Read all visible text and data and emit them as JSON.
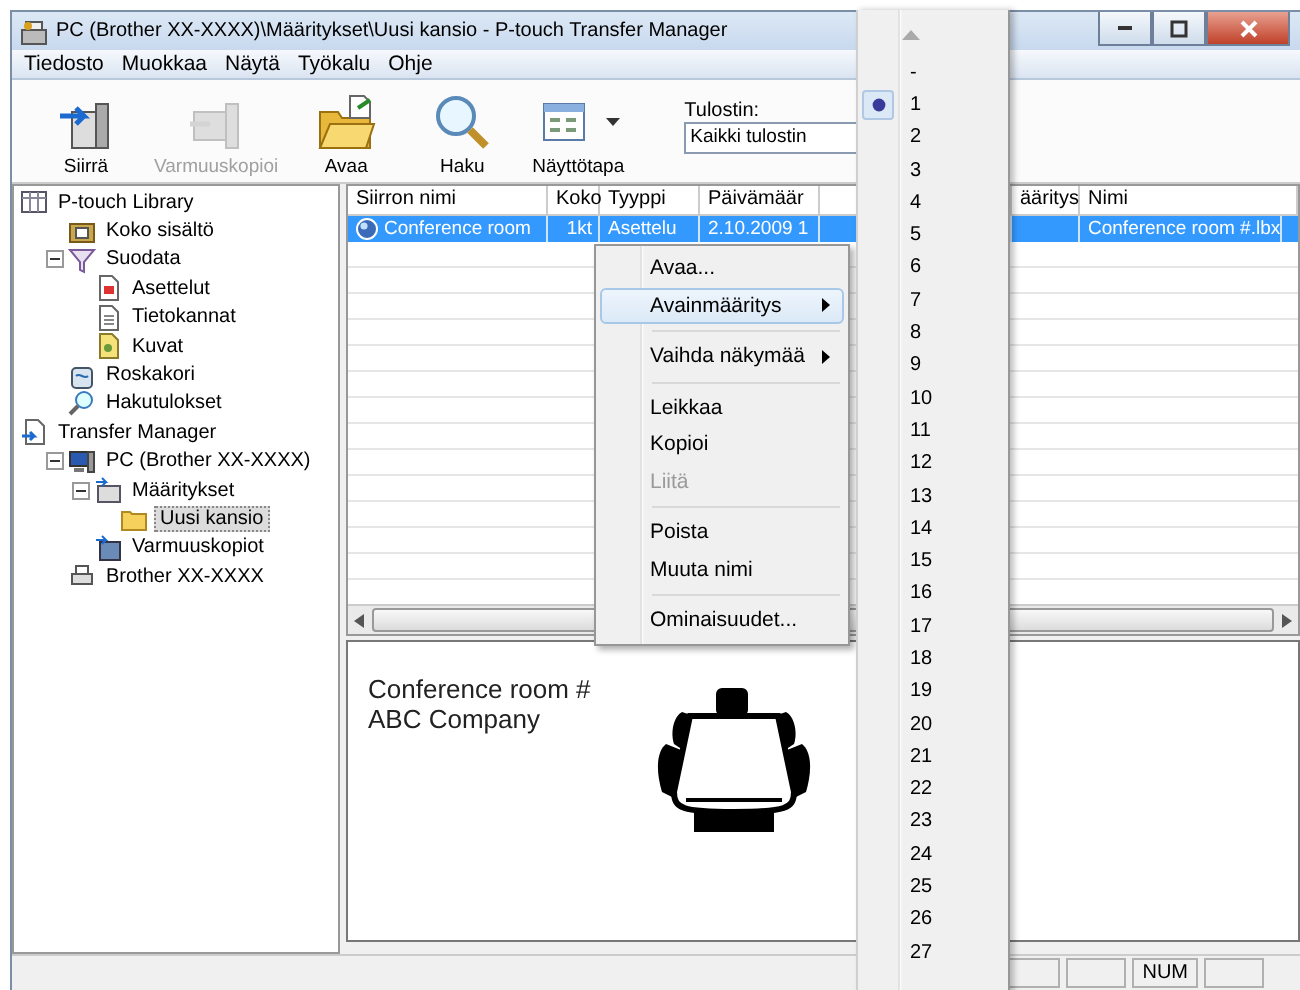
{
  "window": {
    "title": "PC (Brother XX-XXXX)\\Määritykset\\Uusi kansio - P-touch Transfer Manager"
  },
  "menu_bar": [
    "Tiedosto",
    "Muokkaa",
    "Näytä",
    "Työkalu",
    "Ohje"
  ],
  "toolbar": {
    "buttons": [
      {
        "label": "Siirrä",
        "kind": "transfer",
        "disabled": false,
        "dropdown": false
      },
      {
        "label": "Varmuuskopioi",
        "kind": "backup",
        "disabled": true,
        "dropdown": false
      },
      {
        "label": "Avaa",
        "kind": "open",
        "disabled": false,
        "dropdown": false
      },
      {
        "label": "Haku",
        "kind": "search",
        "disabled": false,
        "dropdown": false
      },
      {
        "label": "Näyttötapa",
        "kind": "view",
        "disabled": false,
        "dropdown": true
      }
    ],
    "printer": {
      "label": "Tulostin:",
      "value": "Kaikki tulostin"
    }
  },
  "tree": [
    {
      "label": "P-touch Library",
      "kind": "library",
      "selected": false,
      "children": [
        {
          "label": "Koko sisältö",
          "kind": "all",
          "selected": false
        },
        {
          "label": "Suodata",
          "kind": "filter",
          "selected": false,
          "expanded": true,
          "children": [
            {
              "label": "Asettelut",
              "kind": "layout",
              "selected": false
            },
            {
              "label": "Tietokannat",
              "kind": "database",
              "selected": false
            },
            {
              "label": "Kuvat",
              "kind": "image",
              "selected": false
            }
          ]
        },
        {
          "label": "Roskakori",
          "kind": "trash",
          "selected": false
        },
        {
          "label": "Hakutulokset",
          "kind": "search",
          "selected": false
        }
      ]
    },
    {
      "label": "Transfer Manager",
      "kind": "transfer",
      "selected": false,
      "children": [
        {
          "label": "PC (Brother XX-XXXX)",
          "kind": "pc",
          "selected": false,
          "expanded": true,
          "children": [
            {
              "label": "Määritykset",
              "kind": "config",
              "selected": false,
              "expanded": true,
              "children": [
                {
                  "label": "Uusi kansio",
                  "kind": "folder",
                  "selected": true
                }
              ]
            },
            {
              "label": "Varmuuskopiot",
              "kind": "backup",
              "selected": false
            }
          ]
        },
        {
          "label": "Brother XX-XXXX",
          "kind": "printer",
          "selected": false
        }
      ]
    }
  ],
  "list": {
    "columns": [
      "Siirron nimi",
      "Koko",
      "Tyyppi",
      "Päivämäär",
      "ääritys",
      "Nimi"
    ],
    "rows": [
      {
        "selected": true,
        "transfer_name": "Conference room",
        "size": "1kt",
        "type": "Asettelu",
        "date": "2.10.2009 1",
        "name": "Conference room #.lbx"
      }
    ]
  },
  "preview": {
    "lines": [
      "Conference room #",
      "ABC Company"
    ]
  },
  "context_menu": [
    {
      "kind": "item",
      "label": "Avaa...",
      "disabled": false,
      "selected": false,
      "submenu": false
    },
    {
      "kind": "item",
      "label": "Avainmääritys",
      "disabled": false,
      "selected": true,
      "submenu": true
    },
    {
      "kind": "separator"
    },
    {
      "kind": "item",
      "label": "Vaihda näkymää",
      "disabled": false,
      "selected": false,
      "submenu": true
    },
    {
      "kind": "separator"
    },
    {
      "kind": "item",
      "label": "Leikkaa",
      "disabled": false,
      "selected": false,
      "submenu": false
    },
    {
      "kind": "item",
      "label": "Kopioi",
      "disabled": false,
      "selected": false,
      "submenu": false
    },
    {
      "kind": "item",
      "label": "Liitä",
      "disabled": true,
      "selected": false,
      "submenu": false
    },
    {
      "kind": "separator"
    },
    {
      "kind": "item",
      "label": "Poista",
      "disabled": false,
      "selected": false,
      "submenu": false
    },
    {
      "kind": "item",
      "label": "Muuta nimi",
      "disabled": false,
      "selected": false,
      "submenu": false
    },
    {
      "kind": "separator"
    },
    {
      "kind": "item",
      "label": "Ominaisuudet...",
      "disabled": false,
      "selected": false,
      "submenu": false
    }
  ],
  "key_menu": [
    {
      "label": "-",
      "selected": false
    },
    {
      "label": "1",
      "selected": true
    },
    {
      "label": "2",
      "selected": false
    },
    {
      "label": "3",
      "selected": false
    },
    {
      "label": "4",
      "selected": false
    },
    {
      "label": "5",
      "selected": false
    },
    {
      "label": "6",
      "selected": false
    },
    {
      "label": "7",
      "selected": false
    },
    {
      "label": "8",
      "selected": false
    },
    {
      "label": "9",
      "selected": false
    },
    {
      "label": "10",
      "selected": false
    },
    {
      "label": "11",
      "selected": false
    },
    {
      "label": "12",
      "selected": false
    },
    {
      "label": "13",
      "selected": false
    },
    {
      "label": "14",
      "selected": false
    },
    {
      "label": "15",
      "selected": false
    },
    {
      "label": "16",
      "selected": false
    },
    {
      "label": "17",
      "selected": false
    },
    {
      "label": "18",
      "selected": false
    },
    {
      "label": "19",
      "selected": false
    },
    {
      "label": "20",
      "selected": false
    },
    {
      "label": "21",
      "selected": false
    },
    {
      "label": "22",
      "selected": false
    },
    {
      "label": "23",
      "selected": false
    },
    {
      "label": "24",
      "selected": false
    },
    {
      "label": "25",
      "selected": false
    },
    {
      "label": "26",
      "selected": false
    },
    {
      "label": "27",
      "selected": false
    }
  ],
  "status_bar": {
    "panels": [
      "NUM"
    ]
  }
}
